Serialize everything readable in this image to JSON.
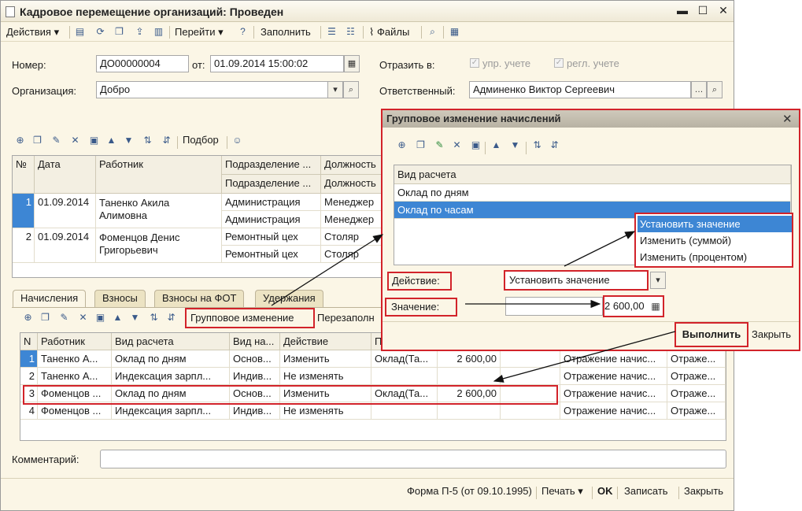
{
  "window": {
    "title": "Кадровое перемещение организаций: Проведен"
  },
  "toolbar": {
    "actions": "Действия",
    "goto": "Перейти",
    "fill": "Заполнить",
    "files": "Файлы"
  },
  "header": {
    "number_label": "Номер:",
    "number_value": "ДО00000004",
    "from_label": "от:",
    "date_value": "01.09.2014 15:00:02",
    "reflect_label": "Отразить в:",
    "upr_label": "упр. учете",
    "regl_label": "регл. учете",
    "org_label": "Организация:",
    "org_value": "Добро",
    "resp_label": "Ответственный:",
    "resp_value": "Админенко Виктор Сергеевич"
  },
  "employees_toolbar": {
    "pick": "Подбор"
  },
  "employees_grid": {
    "headers": [
      "№",
      "Дата",
      "Работник",
      "Подразделение ...",
      "Должность"
    ],
    "subheaders": [
      "Подразделение ...",
      "Должность"
    ],
    "rows": [
      {
        "n": "1",
        "date": "01.09.2014",
        "worker1": "Таненко Акила",
        "worker2": "Алимовна",
        "dept1": "Администрация",
        "dept2": "Администрация",
        "pos1": "Менеджер",
        "pos2": "Менеджер"
      },
      {
        "n": "2",
        "date": "01.09.2014",
        "worker1": "Фоменцов Денис",
        "worker2": "Григорьевич",
        "dept1": "Ремонтный цех",
        "dept2": "Ремонтный цех",
        "pos1": "Столяр",
        "pos2": "Столяр"
      }
    ]
  },
  "tabs": [
    "Начисления",
    "Взносы",
    "Взносы на ФОТ",
    "Удержания"
  ],
  "accruals_toolbar": {
    "group_change": "Групповое изменение",
    "refill": "Перезаполн"
  },
  "accruals_grid": {
    "headers": [
      "N",
      "Работник",
      "Вид расчета",
      "Вид на...",
      "Действие",
      "П"
    ],
    "rows": [
      {
        "n": "1",
        "worker": "Таненко А...",
        "calc": "Оклад по дням",
        "kind": "Основ...",
        "action": "Изменить",
        "p": "Оклад(Та...",
        "value": "2 600,00",
        "refl": "Отражение начис...",
        "refl2": "Отраже..."
      },
      {
        "n": "2",
        "worker": "Таненко А...",
        "calc": "Индексация зарпл...",
        "kind": "Индив...",
        "action": "Не изменять",
        "p": "",
        "value": "",
        "refl": "Отражение начис...",
        "refl2": "Отраже..."
      },
      {
        "n": "3",
        "worker": "Фоменцов ...",
        "calc": "Оклад по дням",
        "kind": "Основ...",
        "action": "Изменить",
        "p": "Оклад(Та...",
        "value": "2 600,00",
        "refl": "Отражение начис...",
        "refl2": "Отраже..."
      },
      {
        "n": "4",
        "worker": "Фоменцов ...",
        "calc": "Индексация зарпл...",
        "kind": "Индив...",
        "action": "Не изменять",
        "p": "",
        "value": "",
        "refl": "Отражение начис...",
        "refl2": "Отраже..."
      }
    ]
  },
  "comment_label": "Комментарий:",
  "footer": {
    "form": "Форма П-5 (от 09.10.1995)",
    "print": "Печать",
    "ok": "OK",
    "save": "Записать",
    "close": "Закрыть"
  },
  "dialog": {
    "title": "Групповое изменение начислений",
    "list_header": "Вид расчета",
    "items": [
      "Оклад по дням",
      "Оклад по часам"
    ],
    "action_label": "Действие:",
    "action_value": "Установить значение",
    "value_label": "Значение:",
    "value_value": "2 600,00",
    "execute": "Выполнить",
    "close": "Закрыть"
  },
  "dropdown": {
    "options": [
      "Установить значение",
      "Изменить (суммой)",
      "Изменить (процентом)"
    ]
  },
  "colors": {
    "accent_red": "#d2232a",
    "selection_blue": "#3d86d4",
    "window_bg": "#fbf6e6"
  }
}
